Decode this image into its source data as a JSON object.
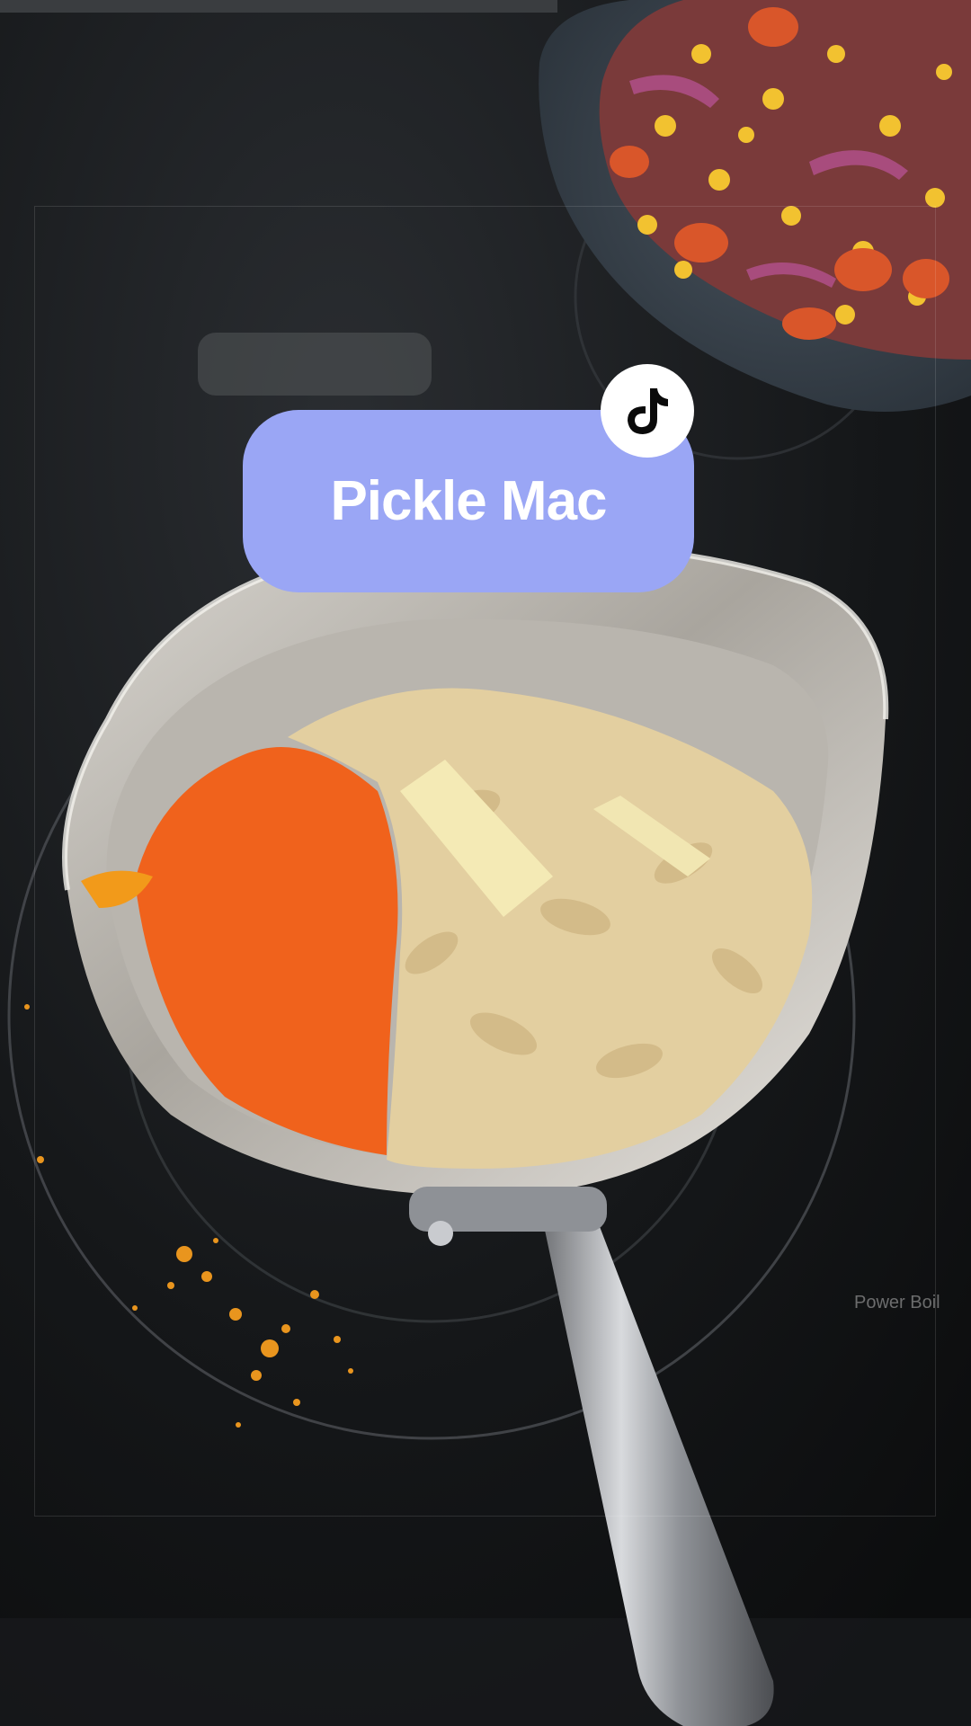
{
  "video_title": "Pickle Mac",
  "icons": {
    "logo": "tiktok-icon"
  },
  "colors": {
    "title_pill": "#9aa6f5",
    "title_text": "#ffffff",
    "cheese_powder": "#f0621c"
  },
  "scene": {
    "stove_label": "Power Boil"
  }
}
